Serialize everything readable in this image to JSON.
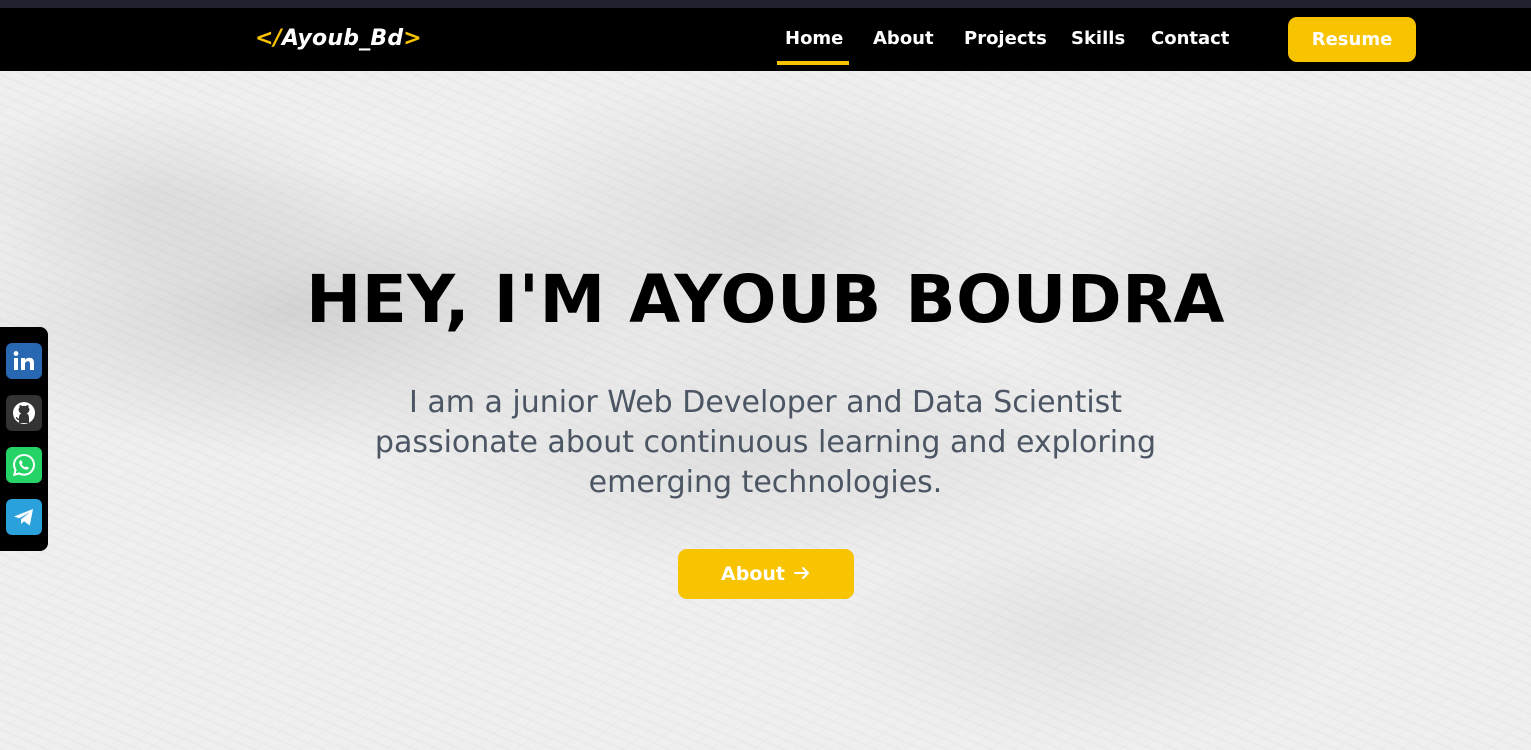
{
  "header": {
    "logo": {
      "prefix": "</",
      "name": "Ayoub_Bd",
      "suffix": ">"
    },
    "nav": [
      {
        "label": "Home",
        "active": true
      },
      {
        "label": "About",
        "active": false
      },
      {
        "label": "Projects",
        "active": false
      },
      {
        "label": "Skills",
        "active": false
      },
      {
        "label": "Contact",
        "active": false
      }
    ],
    "resume_label": "Resume"
  },
  "hero": {
    "title": "HEY, I'M AYOUB BOUDRA",
    "subtitle_lines": [
      "I am a junior Web Developer and Data Scientist",
      "passionate about continuous learning and exploring",
      "emerging technologies."
    ],
    "cta_label": "About",
    "cta_icon": "arrow-right-icon"
  },
  "social": [
    {
      "name": "linkedin-icon",
      "color": "#2867b2"
    },
    {
      "name": "github-icon",
      "color": "#333333"
    },
    {
      "name": "whatsapp-icon",
      "color": "#25d366"
    },
    {
      "name": "telegram-icon",
      "color": "#2aa1da"
    }
  ],
  "colors": {
    "accent": "#f8c300",
    "nav_background": "#000000",
    "hero_background": "#efefef",
    "subtitle_text": "#4b5563"
  }
}
